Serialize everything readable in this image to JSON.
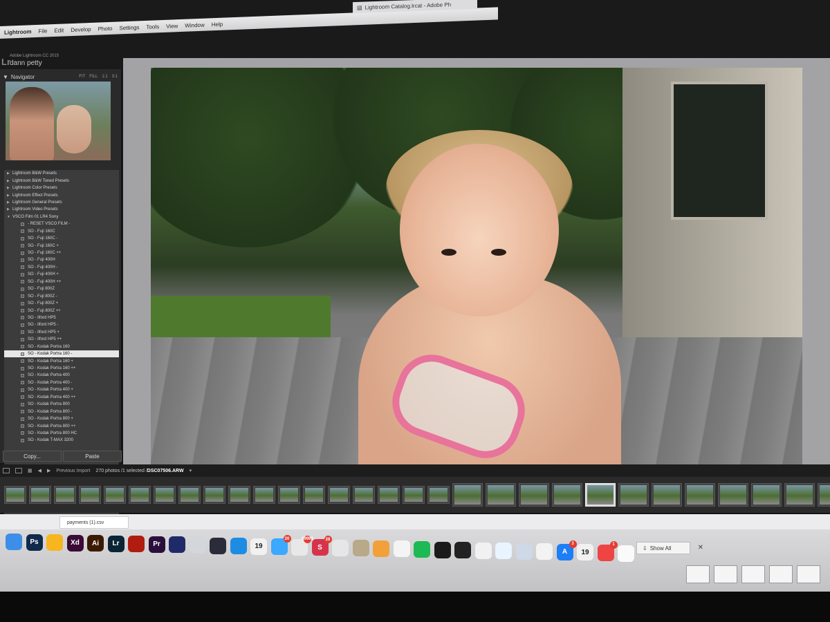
{
  "window": {
    "title": "Lightroom Catalog.lrcat - Adobe Ph"
  },
  "menubar": {
    "app": "Lightroom",
    "items": [
      "File",
      "Edit",
      "Develop",
      "Photo",
      "Settings",
      "Tools",
      "View",
      "Window",
      "Help"
    ]
  },
  "identity": {
    "product": "Adobe Lightroom CC 2015",
    "user": "dann petty",
    "logo": "Lr"
  },
  "navigator": {
    "title": "Navigator",
    "zoom_options": [
      "FIT",
      "FILL",
      "1:1",
      "3:1"
    ]
  },
  "presets": [
    {
      "type": "group",
      "label": "Lightroom B&W Presets"
    },
    {
      "type": "group",
      "label": "Lightroom B&W Toned Presets"
    },
    {
      "type": "group",
      "label": "Lightroom Color Presets"
    },
    {
      "type": "group",
      "label": "Lightroom Effect Presets"
    },
    {
      "type": "group",
      "label": "Lightroom General Presets"
    },
    {
      "type": "group",
      "label": "Lightroom Video Presets"
    },
    {
      "type": "group",
      "label": "VSCO Film 01 LR4 Sony",
      "open": true
    },
    {
      "type": "item",
      "label": "- RESET VSCO FILM -"
    },
    {
      "type": "item",
      "label": "SO - Fuji 160C"
    },
    {
      "type": "item",
      "label": "SO - Fuji 160C -"
    },
    {
      "type": "item",
      "label": "SO - Fuji 160C +"
    },
    {
      "type": "item",
      "label": "SO - Fuji 160C ++"
    },
    {
      "type": "item",
      "label": "SO - Fuji 400H"
    },
    {
      "type": "item",
      "label": "SO - Fuji 400H -"
    },
    {
      "type": "item",
      "label": "SO - Fuji 400H +"
    },
    {
      "type": "item",
      "label": "SO - Fuji 400H ++"
    },
    {
      "type": "item",
      "label": "SO - Fuji 800Z"
    },
    {
      "type": "item",
      "label": "SO - Fuji 800Z -"
    },
    {
      "type": "item",
      "label": "SO - Fuji 800Z +"
    },
    {
      "type": "item",
      "label": "SO - Fuji 800Z ++"
    },
    {
      "type": "item",
      "label": "SO - Ilford HP5"
    },
    {
      "type": "item",
      "label": "SO - Ilford HP5 -"
    },
    {
      "type": "item",
      "label": "SO - Ilford HP5 +"
    },
    {
      "type": "item",
      "label": "SO - Ilford HP5 ++"
    },
    {
      "type": "item",
      "label": "SO - Kodak Portra 160"
    },
    {
      "type": "item",
      "label": "SO - Kodak Portra 160 -",
      "selected": true
    },
    {
      "type": "item",
      "label": "SO - Kodak Portra 160 +"
    },
    {
      "type": "item",
      "label": "SO - Kodak Portra 160 ++"
    },
    {
      "type": "item",
      "label": "SO - Kodak Portra 400"
    },
    {
      "type": "item",
      "label": "SO - Kodak Portra 400 -"
    },
    {
      "type": "item",
      "label": "SO - Kodak Portra 400 +"
    },
    {
      "type": "item",
      "label": "SO - Kodak Portra 400 ++"
    },
    {
      "type": "item",
      "label": "SO - Kodak Portra 800"
    },
    {
      "type": "item",
      "label": "SO - Kodak Portra 800 -"
    },
    {
      "type": "item",
      "label": "SO - Kodak Portra 800 +"
    },
    {
      "type": "item",
      "label": "SO - Kodak Portra 800 ++"
    },
    {
      "type": "item",
      "label": "SO - Kodak Portra 800 HC"
    },
    {
      "type": "item",
      "label": "SO - Kodak T-MAX 3200"
    }
  ],
  "panel_buttons": {
    "copy": "Copy...",
    "paste": "Paste"
  },
  "filmstrip": {
    "source": "Previous Import",
    "count": "270 photos /1 selected /",
    "filename": "DSC07506.ARW",
    "thumb_count": 31
  },
  "downloads": {
    "file": "payments (1).csv",
    "show_all": "Show All"
  },
  "dock": {
    "icons": [
      {
        "name": "finder-icon",
        "label": "",
        "color": "#3d8ee8"
      },
      {
        "name": "photoshop-icon",
        "label": "Ps",
        "color": "#0f2a4a"
      },
      {
        "name": "sketch-icon",
        "label": "",
        "color": "#f7b51f"
      },
      {
        "name": "xd-icon",
        "label": "Xd",
        "color": "#3b0a35"
      },
      {
        "name": "illustrator-icon",
        "label": "Ai",
        "color": "#3a1a00"
      },
      {
        "name": "lightroom-icon",
        "label": "Lr",
        "color": "#0b2436"
      },
      {
        "name": "acrobat-icon",
        "label": "",
        "color": "#b11c10"
      },
      {
        "name": "premiere-icon",
        "label": "Pr",
        "color": "#2a0f3a"
      },
      {
        "name": "after-effects-icon",
        "label": "",
        "color": "#1f2a6b"
      },
      {
        "name": "photo-booth-icon",
        "label": "",
        "color": "#d3d6da"
      },
      {
        "name": "final-cut-icon",
        "label": "",
        "color": "#2b2b3a"
      },
      {
        "name": "safari-icon",
        "label": "",
        "color": "#1f8ce3"
      },
      {
        "name": "calendar-icon",
        "label": "19",
        "color": "#f1f1f1"
      },
      {
        "name": "messages-icon",
        "label": "",
        "color": "#3aa9ff",
        "badge": "20"
      },
      {
        "name": "mail-icon",
        "label": "",
        "color": "#e8e8e8",
        "badge": "99999"
      },
      {
        "name": "slack-icon",
        "label": "S",
        "color": "#d6334b",
        "badge": "28"
      },
      {
        "name": "chrome-icon",
        "label": "",
        "color": "#e6e6e6"
      },
      {
        "name": "notes-icon",
        "label": "",
        "color": "#b8a98a"
      },
      {
        "name": "sketchbook-icon",
        "label": "",
        "color": "#f2a13a"
      },
      {
        "name": "mail-outline-icon",
        "label": "",
        "color": "#f4f4f4"
      },
      {
        "name": "spotify-icon",
        "label": "",
        "color": "#1db954"
      },
      {
        "name": "terminal-icon",
        "label": "",
        "color": "#1b1b1b"
      },
      {
        "name": "activity-monitor-icon",
        "label": "",
        "color": "#222"
      },
      {
        "name": "itunes-icon",
        "label": "",
        "color": "#f1f1f1"
      },
      {
        "name": "numbers-icon",
        "label": "",
        "color": "#e8f4ff"
      },
      {
        "name": "preview-icon",
        "label": "",
        "color": "#cfd8e6"
      },
      {
        "name": "textedit-icon",
        "label": "",
        "color": "#f3f3f3"
      },
      {
        "name": "app-store-icon",
        "label": "A",
        "color": "#1e7ef5",
        "badge": "3"
      },
      {
        "name": "calendar-2-icon",
        "label": "19",
        "color": "#f1f1f1"
      },
      {
        "name": "help-lifesaver-icon",
        "label": "",
        "color": "#e44",
        "badge": "1"
      },
      {
        "name": "photos-icon",
        "label": "",
        "color": "#fafafa"
      }
    ]
  }
}
